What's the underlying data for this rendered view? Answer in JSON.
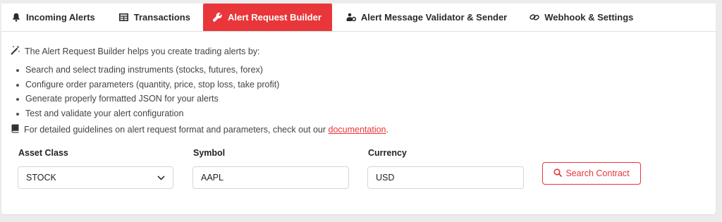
{
  "tabs": [
    {
      "label": "Incoming Alerts",
      "icon": "bell-icon"
    },
    {
      "label": "Transactions",
      "icon": "table-icon"
    },
    {
      "label": "Alert Request Builder",
      "icon": "wrench-icon",
      "active": true
    },
    {
      "label": "Alert Message Validator & Sender",
      "icon": "users-cog-icon"
    },
    {
      "label": "Webhook & Settings",
      "icon": "link-icon"
    }
  ],
  "info": {
    "intro": "The Alert Request Builder helps you create trading alerts by:",
    "bullets": [
      "Search and select trading instruments (stocks, futures, forex)",
      "Configure order parameters (quantity, price, stop loss, take profit)",
      "Generate properly formatted JSON for your alerts",
      "Test and validate your alert configuration"
    ],
    "doc_text": "For detailed guidelines on alert request format and parameters, check out our",
    "doc_link": "documentation",
    "doc_suffix": "."
  },
  "form": {
    "asset_class_label": "Asset Class",
    "asset_class_value": "STOCK",
    "symbol_label": "Symbol",
    "symbol_value": "AAPL",
    "currency_label": "Currency",
    "currency_value": "USD",
    "search_button": "Search Contract"
  },
  "colors": {
    "accent": "#e8363a"
  }
}
